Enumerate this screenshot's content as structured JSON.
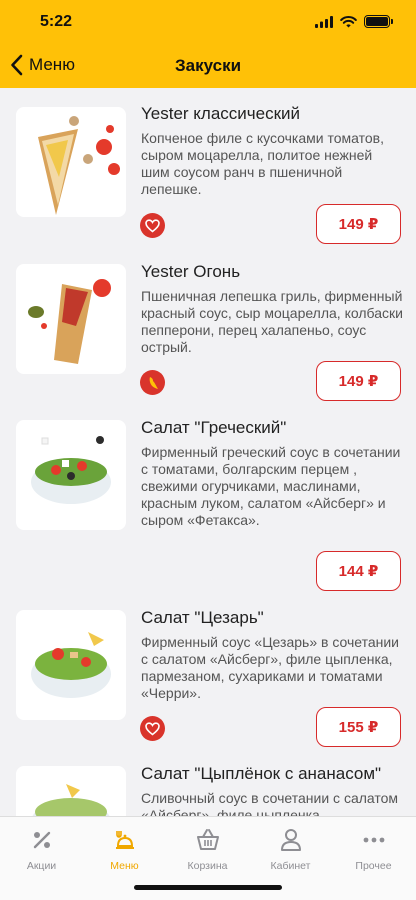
{
  "status_bar": {
    "time": "5:22"
  },
  "header": {
    "back_label": "Меню",
    "title": "Закуски"
  },
  "items": [
    {
      "name": "Yester классический",
      "description": "Копченое филе с кусочками томатов, сыром моцарелла, политое нежней шим соусом ранч в пшеничной лепешке.",
      "price": "149 ₽",
      "badge_icon": "heart-icon"
    },
    {
      "name": "Yester Огонь",
      "description": "Пшеничная лепешка гриль, фирменный красный соус, сыр моцарелла, колбаски пепперони, перец халапеньо, соус острый.",
      "price": "149 ₽",
      "badge_icon": "chili-pepper-icon"
    },
    {
      "name": "Салат \"Греческий\"",
      "description": "Фирменный греческий соус в сочетании с томатами, болгарским перцем , свежими огурчиками, маслинами, красным луком, салатом «Айсберг» и сыром «Фетакса».",
      "price": "144 ₽"
    },
    {
      "name": "Салат \"Цезарь\"",
      "description": "Фирменный соус «Цезарь» в сочетании с салатом «Айсберг», филе цыпленка, пармезаном, сухариками и томатами «Черри».",
      "price": "155 ₽",
      "badge_icon": "heart-icon"
    },
    {
      "name": "Салат \"Цыплёнок с ананасом\"",
      "description": "Сливочный соус в сочетании с салатом «Айсберг», филе цыпленка"
    }
  ],
  "tabbar": {
    "tabs": [
      {
        "label": "Акции",
        "icon": "percent-icon"
      },
      {
        "label": "Меню",
        "icon": "menu-food-icon",
        "active": true
      },
      {
        "label": "Корзина",
        "icon": "basket-icon"
      },
      {
        "label": "Кабинет",
        "icon": "profile-icon"
      },
      {
        "label": "Прочее",
        "icon": "more-icon"
      }
    ]
  },
  "colors": {
    "accent": "#ffc107",
    "price": "#d72a2a",
    "active_tab": "#f0a800"
  }
}
